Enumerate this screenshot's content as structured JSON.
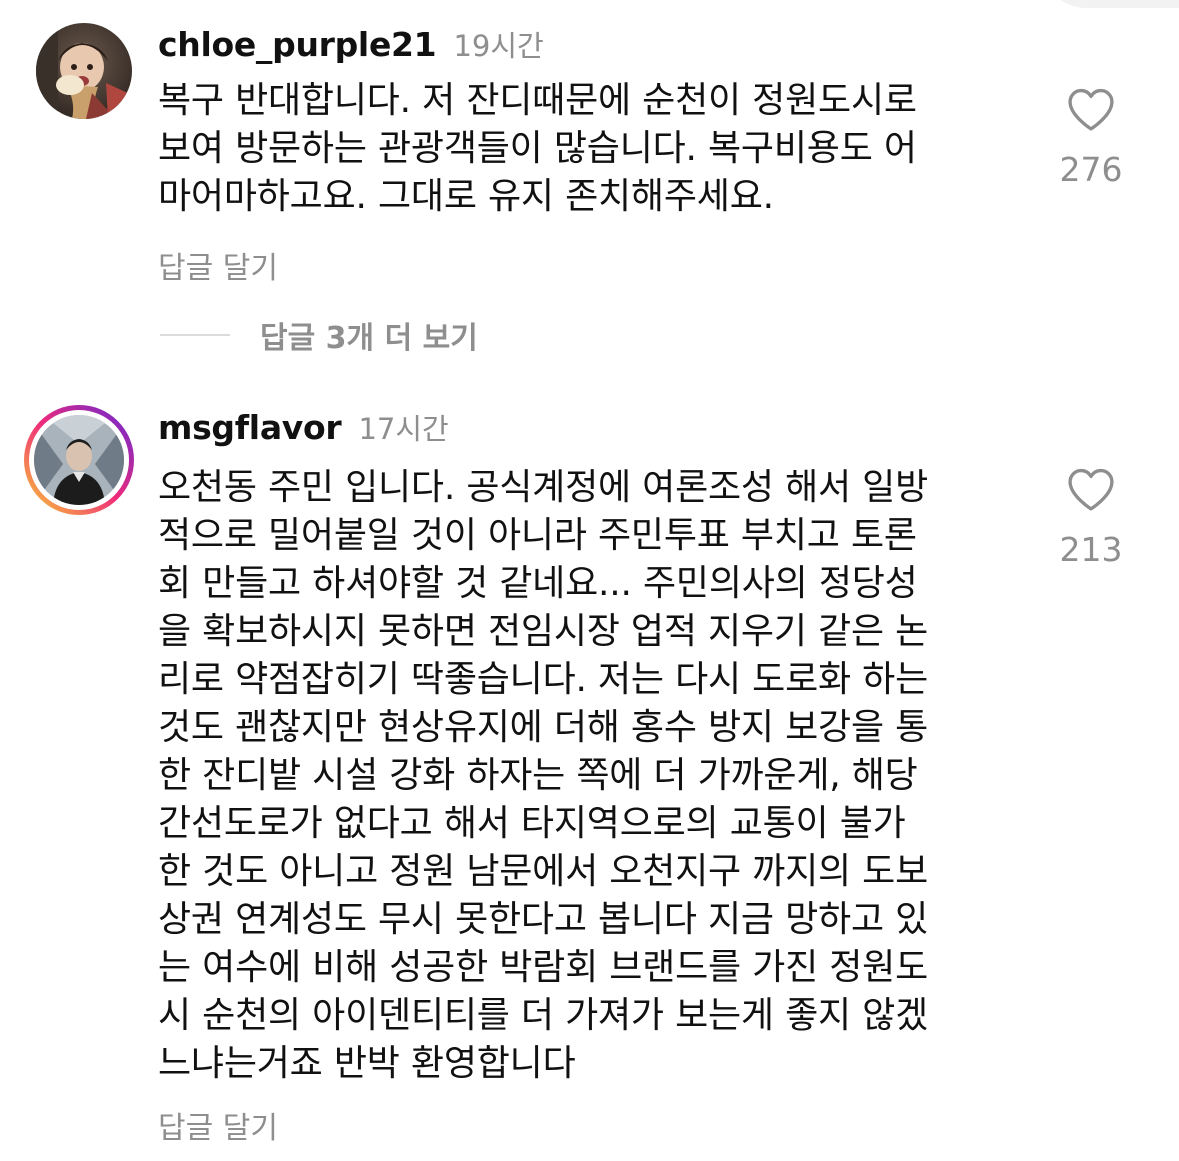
{
  "comments": [
    {
      "username": "chloe_purple21",
      "timestamp": "19시간",
      "lines": [
        "복구 반대합니다. 저 잔디때문에 순천이 정원도시로",
        "보여 방문하는 관광객들이 많습니다. 복구비용도 어",
        "마어마하고요. 그대로 유지 존치해주세요."
      ],
      "reply_label": "답글 달기",
      "view_replies_label": "답글 3개 더 보기",
      "like_count": "276"
    },
    {
      "username": "msgflavor",
      "timestamp": "17시간",
      "lines": [
        "오천동 주민 입니다. 공식계정에 여론조성 해서 일방",
        "적으로 밀어붙일 것이 아니라 주민투표 부치고 토론",
        "회 만들고 하셔야할 것 같네요... 주민의사의 정당성",
        "을 확보하시지 못하면 전임시장 업적 지우기 같은 논",
        "리로 약점잡히기 딱좋습니다. 저는 다시 도로화 하는",
        "것도 괜찮지만 현상유지에 더해 홍수 방지 보강을 통",
        "한 잔디밭 시설 강화 하자는 쪽에 더 가까운게, 해당",
        "간선도로가 없다고 해서 타지역으로의 교통이 불가",
        "한 것도 아니고 정원 남문에서 오천지구 까지의 도보",
        "상권 연계성도 무시 못한다고 봅니다 지금 망하고 있",
        "는 여수에 비해 성공한 박람회 브랜드를 가진 정원도",
        "시 순천의 아이덴티티를 더 가져가 보는게 좋지 않겠",
        "느냐는거죠 반박 환영합니다"
      ],
      "reply_label": "답글 달기",
      "like_count": "213"
    }
  ],
  "colors": {
    "text": "#111111",
    "secondary": "#8e8e8e",
    "divider": "#dbdbdb",
    "story_ring_start": "#f9ce34",
    "story_ring_mid": "#ee2a7b",
    "story_ring_end": "#6228d7"
  }
}
